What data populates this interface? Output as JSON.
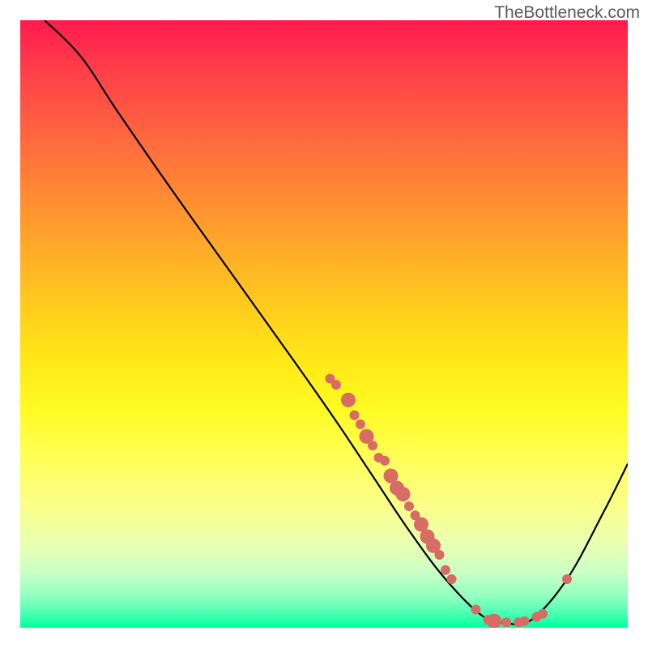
{
  "watermark": "TheBottleneck.com",
  "chart_data": {
    "type": "line",
    "title": "",
    "xlabel": "",
    "ylabel": "",
    "xlim": [
      0,
      100
    ],
    "ylim": [
      0,
      100
    ],
    "grid": false,
    "legend": false,
    "curve_note": "Smooth dip curve; y-values estimated from image (100 top → 0 bottom).",
    "curve": [
      {
        "x": 4,
        "y": 100
      },
      {
        "x": 10,
        "y": 94
      },
      {
        "x": 16,
        "y": 85
      },
      {
        "x": 25,
        "y": 72
      },
      {
        "x": 35,
        "y": 58
      },
      {
        "x": 45,
        "y": 44
      },
      {
        "x": 52,
        "y": 34
      },
      {
        "x": 58,
        "y": 25
      },
      {
        "x": 64,
        "y": 16
      },
      {
        "x": 70,
        "y": 8
      },
      {
        "x": 76,
        "y": 2
      },
      {
        "x": 80,
        "y": 0.8
      },
      {
        "x": 84,
        "y": 1.2
      },
      {
        "x": 90,
        "y": 8
      },
      {
        "x": 96,
        "y": 19
      },
      {
        "x": 100,
        "y": 27
      }
    ],
    "series": [
      {
        "name": "points",
        "points": [
          {
            "x": 51,
            "y": 41
          },
          {
            "x": 52,
            "y": 40
          },
          {
            "x": 54,
            "y": 37.5
          },
          {
            "x": 55,
            "y": 35
          },
          {
            "x": 56,
            "y": 33.5
          },
          {
            "x": 57,
            "y": 31.5
          },
          {
            "x": 58,
            "y": 30
          },
          {
            "x": 59,
            "y": 28
          },
          {
            "x": 60,
            "y": 27.5
          },
          {
            "x": 61,
            "y": 25
          },
          {
            "x": 62,
            "y": 23
          },
          {
            "x": 63,
            "y": 22
          },
          {
            "x": 64,
            "y": 20
          },
          {
            "x": 65,
            "y": 18.5
          },
          {
            "x": 66,
            "y": 17
          },
          {
            "x": 67,
            "y": 15
          },
          {
            "x": 68,
            "y": 13.5
          },
          {
            "x": 69,
            "y": 12
          },
          {
            "x": 70,
            "y": 9.5
          },
          {
            "x": 71,
            "y": 8
          },
          {
            "x": 75,
            "y": 3
          },
          {
            "x": 77,
            "y": 1.3
          },
          {
            "x": 78,
            "y": 1.1
          },
          {
            "x": 80,
            "y": 0.9
          },
          {
            "x": 82,
            "y": 0.9
          },
          {
            "x": 83,
            "y": 1.1
          },
          {
            "x": 85,
            "y": 1.8
          },
          {
            "x": 86,
            "y": 2.3
          },
          {
            "x": 90,
            "y": 8
          }
        ],
        "point_radius_small": 6,
        "point_radius_large": 9,
        "large_indices": [
          2,
          5,
          9,
          10,
          11,
          14,
          15,
          16,
          22
        ]
      }
    ],
    "colors": {
      "curve": "#000000",
      "points": "#d86b63",
      "gradient_top": "#ff1a4d",
      "gradient_bottom": "#00ff9e"
    }
  }
}
